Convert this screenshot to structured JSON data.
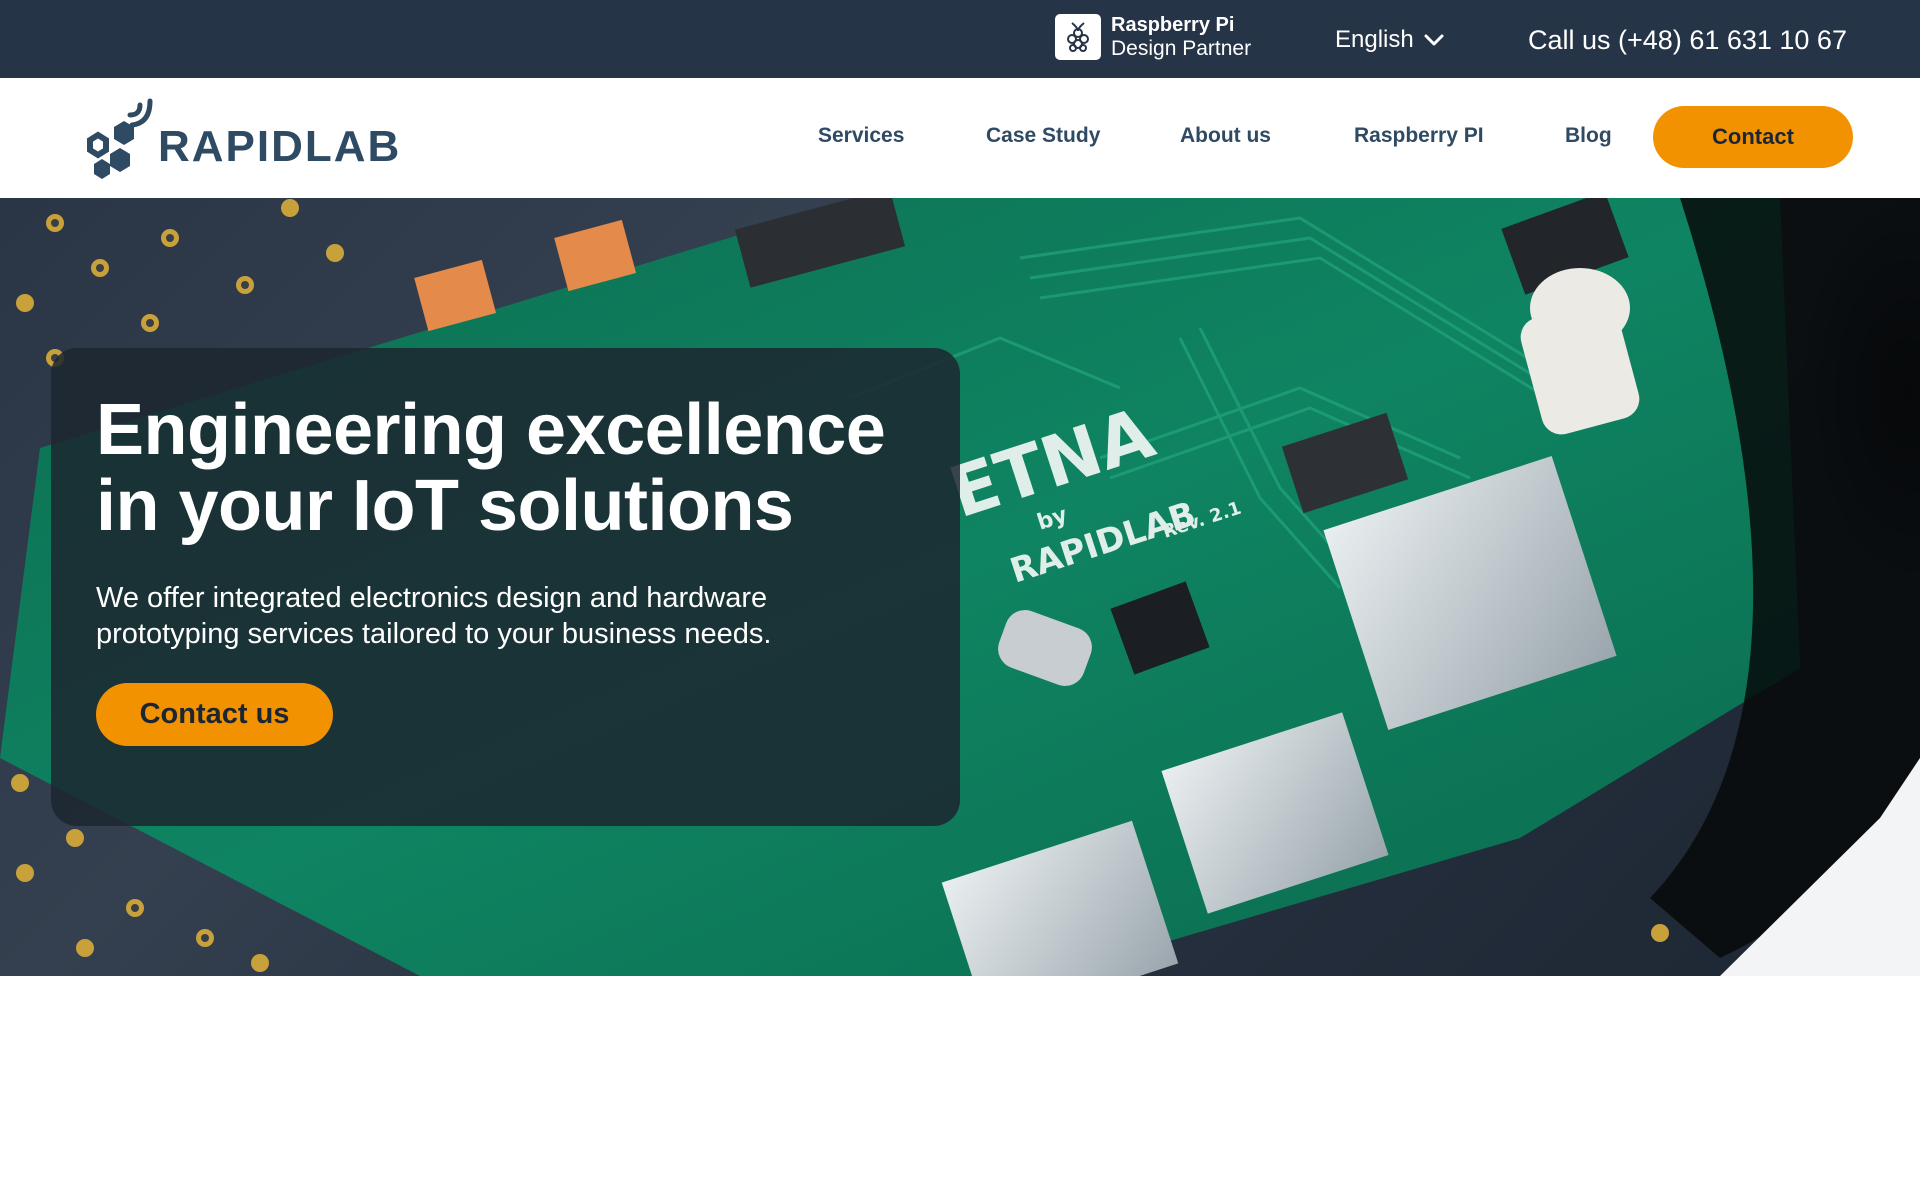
{
  "topbar": {
    "partner_title": "Raspberry Pi",
    "partner_subtitle": "Design Partner",
    "language": "English",
    "phone": "Call us (+48) 61 631 10 67"
  },
  "header": {
    "brand": "RAPIDLAB",
    "nav": {
      "services": "Services",
      "case_study": "Case Study",
      "about": "About us",
      "raspberry": "Raspberry PI",
      "blog": "Blog"
    },
    "contact_label": "Contact"
  },
  "hero": {
    "headline": "Engineering excellence in your IoT solutions",
    "subline": "We offer integrated electronics design and hardware prototyping services tailored to your business needs.",
    "cta_label": "Contact us",
    "board_label": "ETNA",
    "board_by": "by",
    "board_brand": "RAPIDLAB",
    "board_rev": "Rev. 2.1"
  },
  "colors": {
    "topbar_bg": "#253447",
    "brand_text": "#2f4a63",
    "accent": "#f39200",
    "pcb_green": "#0f7a5a"
  },
  "icons": {
    "partner": "raspberry-pi-icon",
    "language": "chevron-down-icon",
    "logo": "hexagon-signal-logo"
  }
}
